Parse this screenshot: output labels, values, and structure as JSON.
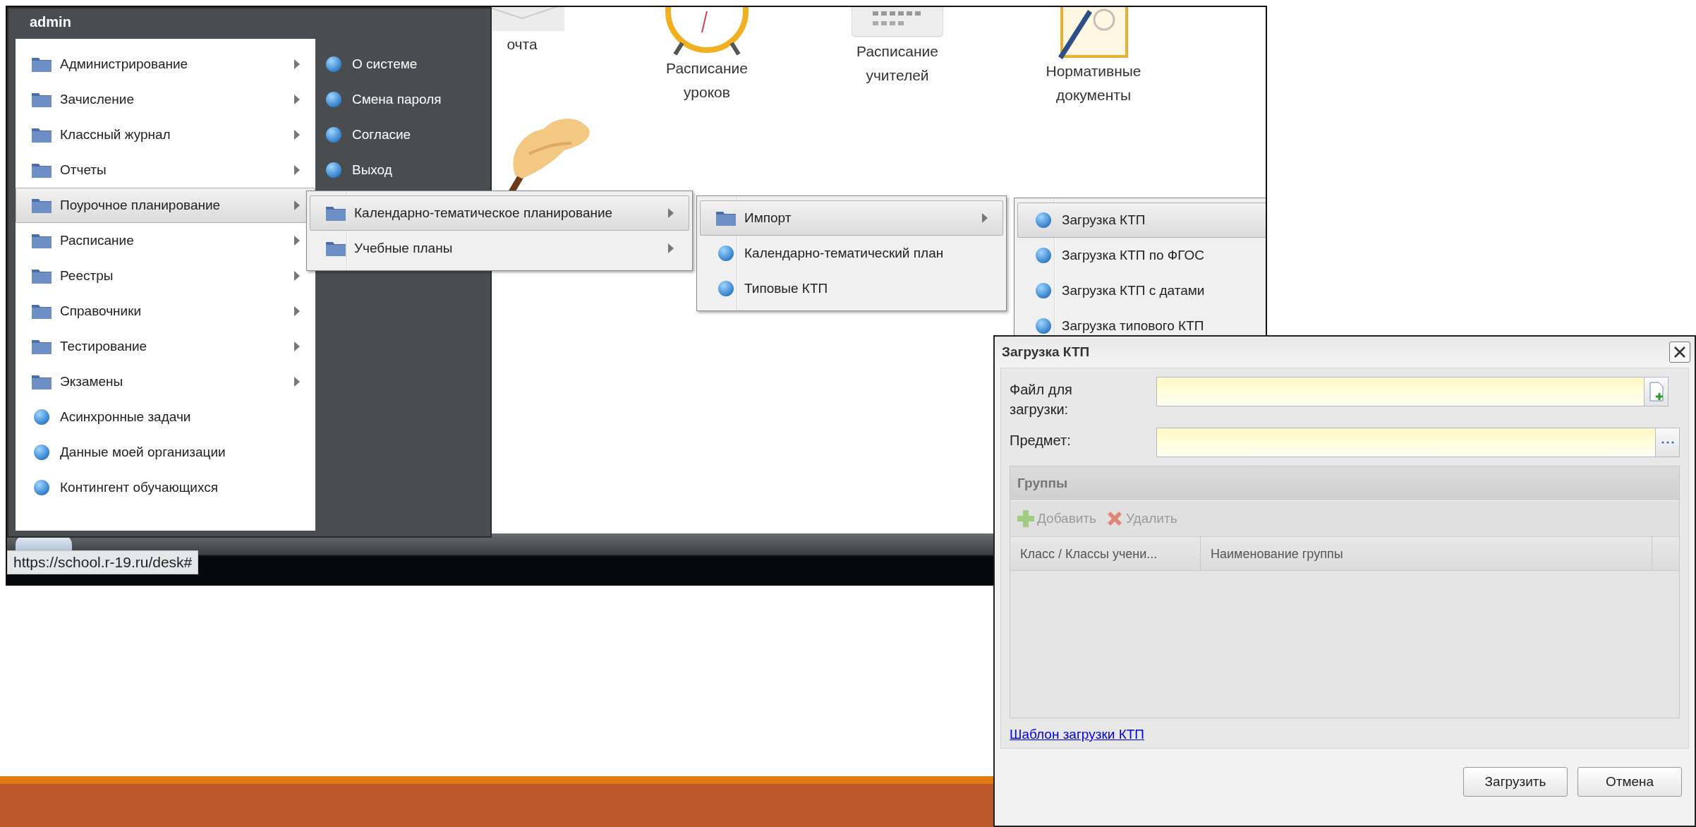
{
  "start_menu": {
    "user": "admin",
    "items": [
      {
        "label": "Администрирование",
        "kind": "folder",
        "selected": false
      },
      {
        "label": "Зачисление",
        "kind": "folder",
        "selected": false
      },
      {
        "label": "Классный журнал",
        "kind": "folder",
        "selected": false
      },
      {
        "label": "Отчеты",
        "kind": "folder",
        "selected": false
      },
      {
        "label": "Поурочное планирование",
        "kind": "folder",
        "selected": true
      },
      {
        "label": "Расписание",
        "kind": "folder",
        "selected": false
      },
      {
        "label": "Реестры",
        "kind": "folder",
        "selected": false
      },
      {
        "label": "Справочники",
        "kind": "folder",
        "selected": false
      },
      {
        "label": "Тестирование",
        "kind": "folder",
        "selected": false
      },
      {
        "label": "Экзамены",
        "kind": "folder",
        "selected": false
      },
      {
        "label": "Асинхронные задачи",
        "kind": "item",
        "selected": false
      },
      {
        "label": "Данные моей организации",
        "kind": "item",
        "selected": false
      },
      {
        "label": "Контингент обучающихся",
        "kind": "item",
        "selected": false
      }
    ],
    "side_items": [
      {
        "label": "О системе"
      },
      {
        "label": "Смена пароля"
      },
      {
        "label": "Согласие"
      },
      {
        "label": "Выход"
      }
    ]
  },
  "submenus": [
    {
      "items": [
        {
          "label": "Календарно-тематическое планирование",
          "kind": "folder",
          "selected": true
        },
        {
          "label": "Учебные планы",
          "kind": "folder",
          "selected": false
        }
      ]
    },
    {
      "items": [
        {
          "label": "Импорт",
          "kind": "folder",
          "selected": true
        },
        {
          "label": "Календарно-тематический план",
          "kind": "item",
          "selected": false
        },
        {
          "label": "Типовые КТП",
          "kind": "item",
          "selected": false
        }
      ]
    },
    {
      "items": [
        {
          "label": "Загрузка КТП",
          "kind": "item",
          "selected": true
        },
        {
          "label": "Загрузка КТП по ФГОС",
          "kind": "item",
          "selected": false
        },
        {
          "label": "Загрузка КТП с датами",
          "kind": "item",
          "selected": false
        },
        {
          "label": "Загрузка типового КТП",
          "kind": "item",
          "selected": false
        }
      ]
    }
  ],
  "desktop_icons": [
    {
      "label": "очта",
      "kind": "mail"
    },
    {
      "label": "Расписание уроков",
      "kind": "clock"
    },
    {
      "label": "Расписание учителей",
      "kind": "calendar"
    },
    {
      "label": "Нормативные документы",
      "kind": "document"
    }
  ],
  "status_url": "https://school.r-19.ru/desk#",
  "dialog": {
    "title": "Загрузка КТП",
    "fields": [
      {
        "label": "Файл для загрузки:",
        "kind": "file"
      },
      {
        "label": "Предмет:",
        "kind": "picker"
      }
    ],
    "groups": {
      "title": "Группы",
      "toolbar": [
        {
          "label": "Добавить",
          "kind": "add",
          "disabled": true
        },
        {
          "label": "Удалить",
          "kind": "delete",
          "disabled": true
        }
      ],
      "columns": [
        "Класс / Классы учени...",
        "Наименование группы"
      ]
    },
    "link": "Шаблон загрузки КТП",
    "buttons": [
      "Загрузить",
      "Отмена"
    ]
  }
}
